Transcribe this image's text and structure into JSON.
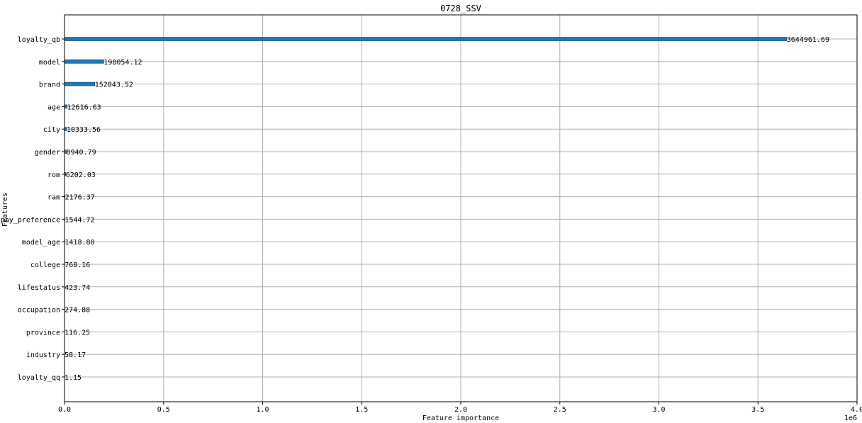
{
  "chart_data": {
    "type": "bar",
    "orientation": "horizontal",
    "title": "0728_SSV",
    "xlabel": "Feature importance",
    "ylabel": "Features",
    "x_scale_label": "1e6",
    "xlim": [
      0,
      4000000
    ],
    "x_ticks": [
      0,
      500000,
      1000000,
      1500000,
      2000000,
      2500000,
      3000000,
      3500000,
      4000000
    ],
    "x_tick_labels": [
      "0.0",
      "0.5",
      "1.0",
      "1.5",
      "2.0",
      "2.5",
      "3.0",
      "3.5",
      "4.0"
    ],
    "grid": true,
    "bar_color": "#1f77b4",
    "categories": [
      "loyalty_qb",
      "model",
      "brand",
      "age",
      "city",
      "gender",
      "rom",
      "ram",
      "pay_preference",
      "model_age",
      "college",
      "lifestatus",
      "occupation",
      "province",
      "industry",
      "loyalty_qq"
    ],
    "values": [
      3644961.69,
      198054.12,
      152843.52,
      12616.63,
      10333.56,
      8940.79,
      6202.03,
      2176.37,
      1544.72,
      1418.8,
      768.16,
      423.74,
      274.88,
      116.25,
      58.17,
      1.15
    ],
    "value_labels": [
      "3644961.69",
      "198054.12",
      "152843.52",
      "12616.63",
      "10333.56",
      "8940.79",
      "6202.03",
      "2176.37",
      "1544.72",
      "1418.80",
      "768.16",
      "423.74",
      "274.88",
      "116.25",
      "58.17",
      "1.15"
    ]
  }
}
